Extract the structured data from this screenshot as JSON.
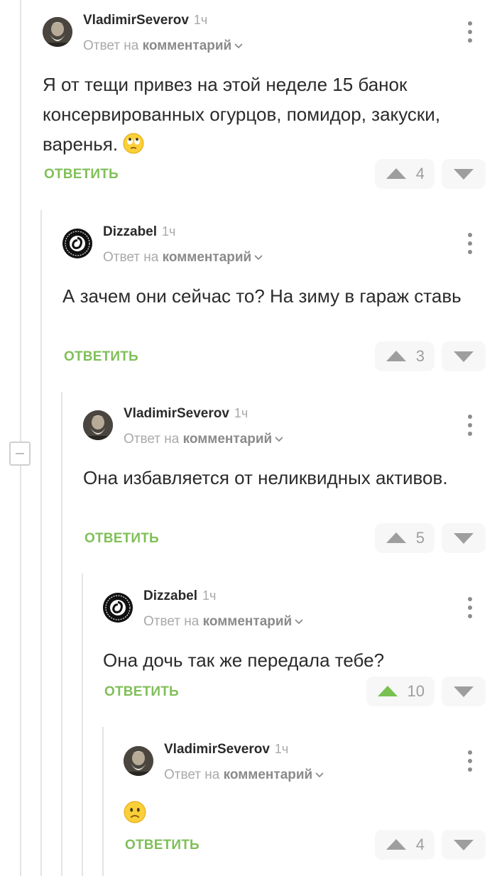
{
  "labels": {
    "reply_prefix": "Ответ на",
    "reply_target": "комментарий",
    "reply_button": "ОТВЕТИТЬ"
  },
  "colors": {
    "accent_green": "#7fbf58",
    "muted_gray": "#9e9e9e",
    "text": "#2b2b2b"
  },
  "comments": [
    {
      "author": "VladimirSeverov",
      "time": "1ч",
      "avatar": "old-man-avatar",
      "text": "Я от тещи привез на этой неделе 15 банок консервированных огурцов, помидор, закуски, варенья.",
      "emoji": "eye-roll-emoji",
      "rating": "4",
      "upvoted": false
    },
    {
      "author": "Dizzabel",
      "time": "1ч",
      "avatar": "black-round-logo-avatar",
      "text": "А зачем они сейчас то? На зиму в гараж ставь",
      "rating": "3",
      "upvoted": false
    },
    {
      "author": "VladimirSeverov",
      "time": "1ч",
      "avatar": "old-man-avatar",
      "text": "Она избавляется от неликвидных активов.",
      "rating": "5",
      "upvoted": false
    },
    {
      "author": "Dizzabel",
      "time": "1ч",
      "avatar": "black-round-logo-avatar",
      "text": "Она дочь так же передала тебе?",
      "rating": "10",
      "upvoted": true
    },
    {
      "author": "VladimirSeverov",
      "time": "1ч",
      "avatar": "old-man-avatar",
      "text": "",
      "emoji": "slightly-frowning-emoji",
      "rating": "4",
      "upvoted": false
    }
  ]
}
